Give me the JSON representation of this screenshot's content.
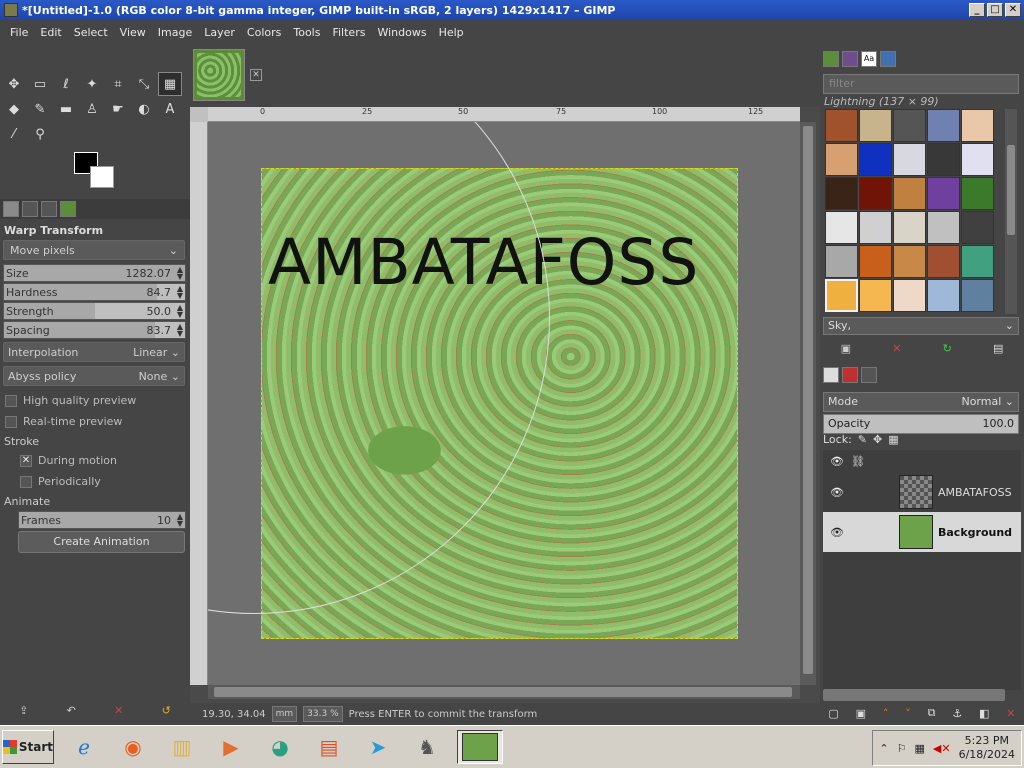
{
  "window": {
    "title": "*[Untitled]-1.0 (RGB color 8-bit gamma integer, GIMP built-in sRGB, 2 layers) 1429x1417 – GIMP",
    "buttons": [
      "_",
      "□",
      "✕"
    ]
  },
  "menubar": [
    "File",
    "Edit",
    "Select",
    "View",
    "Image",
    "Layer",
    "Colors",
    "Tools",
    "Filters",
    "Windows",
    "Help"
  ],
  "toolbox": {
    "tools": [
      {
        "name": "move-tool-icon",
        "glyph": "✥"
      },
      {
        "name": "rect-select-icon",
        "glyph": "▭"
      },
      {
        "name": "free-select-icon",
        "glyph": "ℓ"
      },
      {
        "name": "fuzzy-select-icon",
        "glyph": "✦"
      },
      {
        "name": "crop-icon",
        "glyph": "⌗"
      },
      {
        "name": "transform-icon",
        "glyph": "⤡"
      },
      {
        "name": "warp-transform-icon",
        "glyph": "▦"
      },
      {
        "name": "paint-bucket-icon",
        "glyph": "◆"
      },
      {
        "name": "paintbrush-icon",
        "glyph": "✎"
      },
      {
        "name": "eraser-icon",
        "glyph": "▬"
      },
      {
        "name": "clone-icon",
        "glyph": "♙"
      },
      {
        "name": "smudge-icon",
        "glyph": "☛"
      },
      {
        "name": "dodge-icon",
        "glyph": "◐"
      },
      {
        "name": "text-tool-icon",
        "glyph": "A"
      },
      {
        "name": "color-picker-icon",
        "glyph": "⁄"
      },
      {
        "name": "zoom-icon",
        "glyph": "⚲"
      }
    ]
  },
  "tool_options": {
    "title": "Warp Transform",
    "mode": "Move pixels",
    "size_label": "Size",
    "size_value": "1282.07",
    "hardness_label": "Hardness",
    "hardness_value": "84.7",
    "strength_label": "Strength",
    "strength_value": "50.0",
    "spacing_label": "Spacing",
    "spacing_value": "83.7",
    "interpolation_label": "Interpolation",
    "interpolation_value": "Linear",
    "abyss_label": "Abyss policy",
    "abyss_value": "None",
    "hq_preview": "High quality preview",
    "realtime_preview": "Real-time preview",
    "stroke_label": "Stroke",
    "during_motion": "During motion",
    "periodically": "Periodically",
    "animate_label": "Animate",
    "frames_label": "Frames",
    "frames_value": "10",
    "create_animation": "Create Animation",
    "hardness_fill": 0.847,
    "strength_fill": 0.5,
    "spacing_fill": 0.837
  },
  "canvas": {
    "text_layer": "AMBATAFOSS",
    "ruler_ticks": [
      "0",
      "25",
      "50",
      "75",
      "100",
      "125"
    ]
  },
  "statusbar": {
    "coords": "19.30, 34.04",
    "unit": "mm",
    "zoom": "33.3 %",
    "message": "Press ENTER to commit the transform"
  },
  "patterns": {
    "filter_placeholder": "filter",
    "selected_name": "Lightning (137 × 99)",
    "tag_combo": "Sky,",
    "swatches": [
      "#a0522d",
      "#c8b48c",
      "#555555",
      "#7080b0",
      "#e8c8a8",
      "#d6a070",
      "#1030c0",
      "#d8d8e0",
      "#383838",
      "#e0e0f0",
      "#3a2418",
      "#701408",
      "#c08040",
      "#7040a0",
      "#3a7a2a",
      "#e6e6e6",
      "#d0d0d0",
      "#d8d4c8",
      "#c0c0c0",
      "#404040",
      "#a8a8a8",
      "#c8601c",
      "#c88848",
      "#a05030",
      "#40a080",
      "#f0b040",
      "#f5b850",
      "#eed8c8",
      "#a0b8d8",
      "#6080a0"
    ]
  },
  "layers": {
    "mode_label": "Mode",
    "mode_value": "Normal",
    "opacity_label": "Opacity",
    "opacity_value": "100.0",
    "lock_label": "Lock:",
    "items": [
      {
        "name": "AMBATAFOSS",
        "selected": false
      },
      {
        "name": "Background",
        "selected": true
      }
    ]
  },
  "taskbar": {
    "start": "Start",
    "time": "5:23 PM",
    "date": "6/18/2024"
  }
}
